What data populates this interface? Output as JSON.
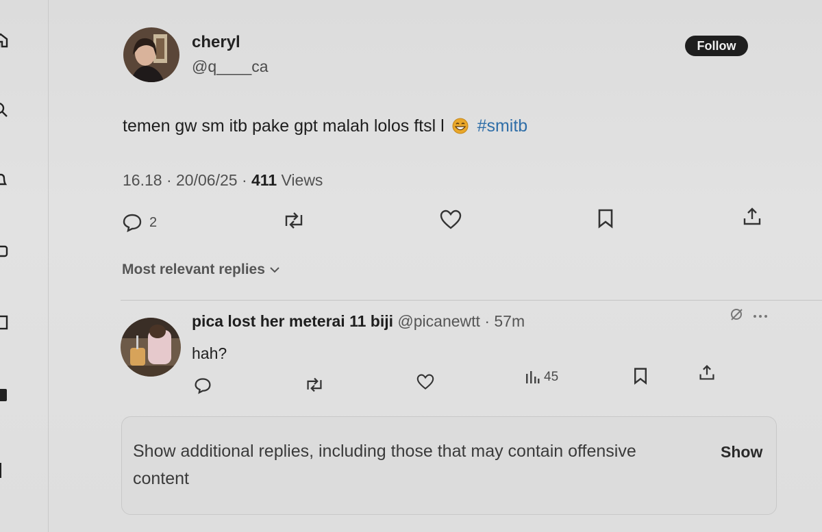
{
  "post": {
    "author_name": "cheryl",
    "author_handle": "@q____ca",
    "follow_label": "Follow",
    "text": "temen gw sm itb pake gpt malah lolos ftsl l",
    "emoji": "grinning-face-with-smiling-eyes",
    "hashtag": "#smitb",
    "time": "16.18",
    "date": "20/06/25",
    "views_count": "411",
    "views_label": "Views",
    "reply_count": "2"
  },
  "replies_section": {
    "sort_label": "Most relevant replies"
  },
  "reply": {
    "author_name": "pica lost her meterai 11 biji",
    "author_handle": "@picanewtt",
    "time_ago": "57m",
    "text": "hah?",
    "views_count": "45"
  },
  "notice": {
    "text": "Show additional replies, including those that may contain offensive content",
    "show_label": "Show"
  },
  "colors": {
    "background": "#e0e0e0",
    "hashtag": "#2f6ea8",
    "follow_button": "#1e1e1e"
  },
  "icons": [
    "home-icon",
    "search-icon",
    "notifications-icon",
    "messages-icon",
    "bookmarks-icon",
    "profile-icon",
    "reply-icon",
    "retweet-icon",
    "like-icon",
    "bookmark-icon",
    "share-icon",
    "views-icon",
    "more-icon",
    "grok-icon",
    "chevron-down-icon"
  ]
}
